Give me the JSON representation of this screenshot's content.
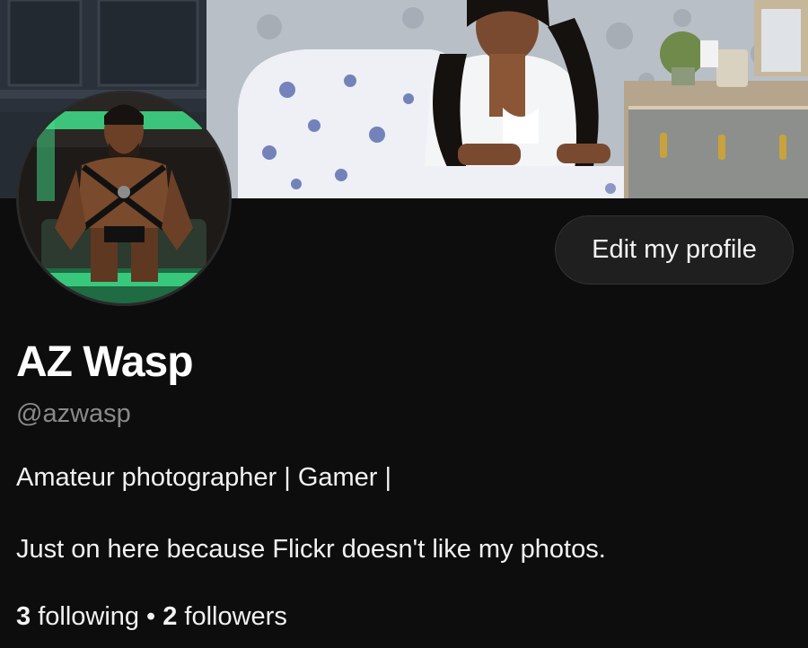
{
  "profile": {
    "display_name": "AZ Wasp",
    "handle": "@azwasp",
    "bio_line_1": "Amateur photographer | Gamer |",
    "bio_line_2": "Just on here because Flickr doesn't like my photos."
  },
  "actions": {
    "edit_profile_label": "Edit my profile"
  },
  "stats": {
    "following_count": "3",
    "following_label": "following",
    "separator": "•",
    "followers_count": "2",
    "followers_label": "followers"
  },
  "colors": {
    "background": "#0d0d0d",
    "button_bg": "#1f1f1f",
    "handle_text": "#8a8a8a",
    "avatar_glow": "#3fe08a"
  }
}
